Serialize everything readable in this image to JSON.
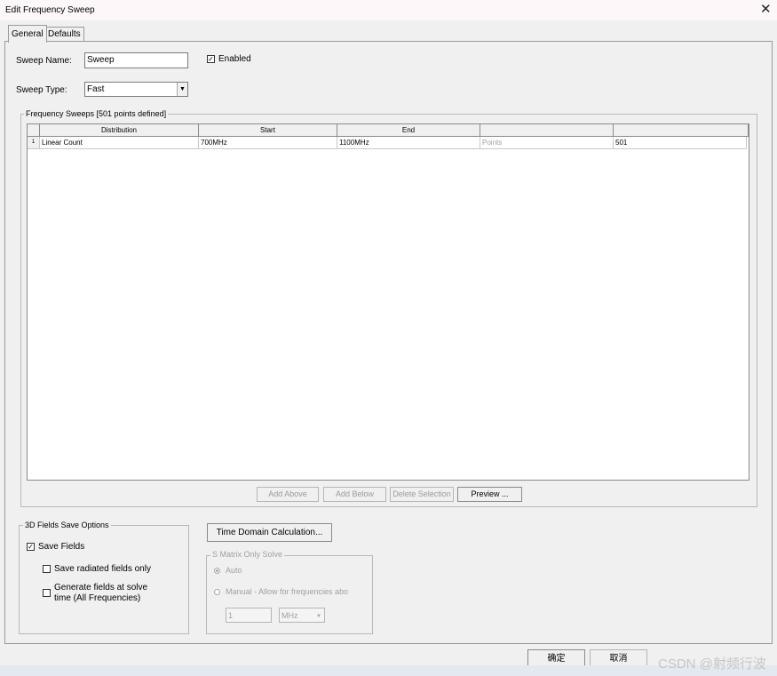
{
  "window": {
    "title": "Edit Frequency Sweep",
    "close_glyph": "✕"
  },
  "tabs": [
    {
      "label": "General"
    },
    {
      "label": "Defaults"
    }
  ],
  "form": {
    "sweep_name_label": "Sweep Name:",
    "sweep_name_value": "Sweep",
    "enabled_label": "Enabled",
    "enabled_checked": true,
    "sweep_type_label": "Sweep Type:",
    "sweep_type_value": "Fast"
  },
  "frequency_sweeps": {
    "title": "Frequency Sweeps [501 points defined]",
    "columns": [
      "Distribution",
      "Start",
      "End",
      "",
      ""
    ],
    "rows": [
      {
        "index": "1",
        "distribution": "Linear Count",
        "start": "700MHz",
        "end": "1100MHz",
        "unit_label": "Points",
        "count": "501"
      }
    ],
    "buttons": {
      "add_above": "Add Above",
      "add_below": "Add Below",
      "delete_selection": "Delete Selection",
      "preview": "Preview ..."
    }
  },
  "fields_options": {
    "title": "3D Fields Save Options",
    "save_fields": "Save Fields",
    "save_fields_checked": true,
    "save_radiated_only": "Save radiated fields only",
    "generate_fields_line1": "Generate fields at solve",
    "generate_fields_line2": "time (All Frequencies)"
  },
  "time_domain_button": "Time Domain Calculation...",
  "s_matrix": {
    "title": "S Matrix Only Solve",
    "auto": "Auto",
    "manual": "Manual -  Allow for frequencies abo",
    "value": "1",
    "unit": "MHz"
  },
  "dialog_buttons": {
    "ok": "确定",
    "cancel": "取消"
  },
  "watermark": "CSDN @射频行波"
}
